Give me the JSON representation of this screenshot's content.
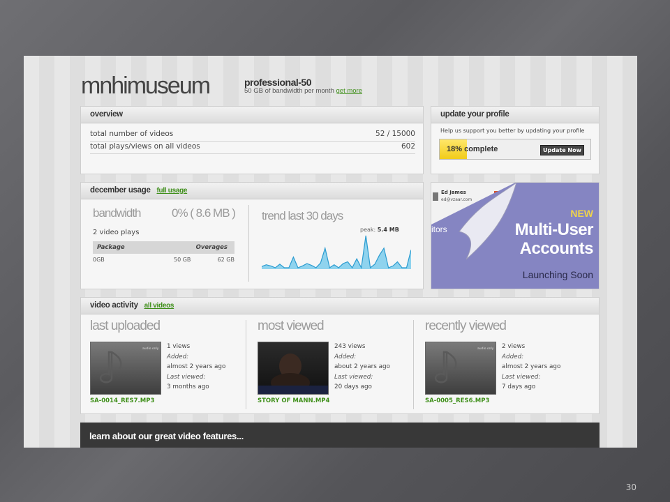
{
  "header": {
    "brand": "mnhimuseum",
    "plan": "professional-50",
    "plan_desc": "50 GB of bandwidth per month",
    "get_more": "get more"
  },
  "overview": {
    "title": "overview",
    "rows": [
      {
        "label": "total number of videos",
        "value": "52 / 15000"
      },
      {
        "label": "total plays/views on all videos",
        "value": "602"
      }
    ]
  },
  "profile": {
    "title": "update your profile",
    "help": "Help us support you better by updating your profile",
    "progress_percent": 18,
    "progress_label": "18% complete",
    "button": "Update Now"
  },
  "usage": {
    "title": "december usage",
    "full_usage": "full usage",
    "bandwidth_label": "bandwidth",
    "bandwidth_value": "0% ( 8.6 MB )",
    "plays": "2 video plays",
    "table_headers": [
      "Package",
      "Overages"
    ],
    "table_values": [
      "0GB",
      "50 GB",
      "62 GB"
    ],
    "trend_title": "trend last 30 days",
    "peak_label": "peak:",
    "peak_value": "5.4 MB",
    "trend_values": [
      0.2,
      0.5,
      0.3,
      0.0,
      0.6,
      0.0,
      0.0,
      1.8,
      0.0,
      0.3,
      0.7,
      0.4,
      0.0,
      0.8,
      3.3,
      0.0,
      0.5,
      0.0,
      0.7,
      1.0,
      0.0,
      1.5,
      0.0,
      5.4,
      0.0,
      0.6,
      2.1,
      3.3,
      0.0,
      0.3,
      1.0,
      0.0,
      0.0,
      3.0
    ]
  },
  "ad": {
    "user_name": "Ed James",
    "user_email": "ed@vzaar.com",
    "editors_fragment": "itors",
    "new": "NEW",
    "title_line1": "Multi-User",
    "title_line2": "Accounts",
    "subtitle": "Launching Soon",
    "colors": {
      "background": "#8585c2",
      "accent": "#f0d44a"
    }
  },
  "activity": {
    "title": "video activity",
    "all_videos": "all videos",
    "columns": [
      {
        "heading": "last uploaded",
        "views": "1 views",
        "added_label": "Added:",
        "added": "almost 2 years ago",
        "last_label": "Last viewed:",
        "last": "3 months ago",
        "file": "SA-0014_RES7.MP3",
        "thumb_caption": "audio only"
      },
      {
        "heading": "most viewed",
        "views": "243 views",
        "added_label": "Added:",
        "added": "about 2 years ago",
        "last_label": "Last viewed:",
        "last": "20 days ago",
        "file": "STORY OF MANN.MP4"
      },
      {
        "heading": "recently viewed",
        "views": "2 views",
        "added_label": "Added:",
        "added": "almost 2 years ago",
        "last_label": "Last viewed:",
        "last": "7 days ago",
        "file": "SA-0005_RES6.MP3",
        "thumb_caption": "audio only"
      }
    ]
  },
  "banner": "learn about our great video features...",
  "slide_number": "30"
}
